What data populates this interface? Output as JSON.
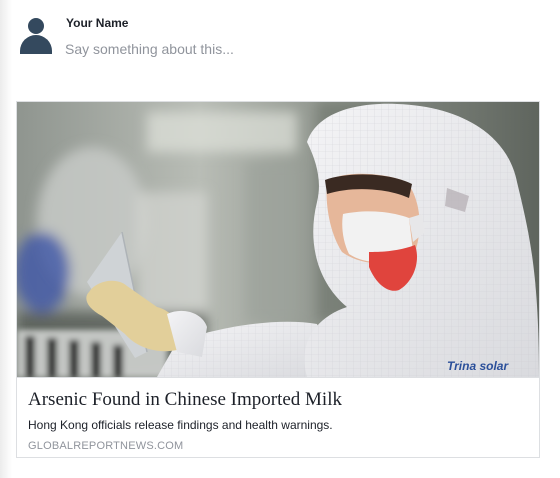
{
  "composer": {
    "user_name": "Your Name",
    "placeholder": "Say something about this...",
    "avatar_icon": "user-silhouette-icon"
  },
  "link_preview": {
    "title": "Arsenic Found in Chinese Imported Milk",
    "description": "Hong Kong officials release findings and health warnings.",
    "domain": "GLOBALREPORTNEWS.COM",
    "image_logo_text": "Trina solar"
  },
  "colors": {
    "avatar": "#34495e",
    "text_primary": "#1d2129",
    "text_secondary": "#90949c",
    "border": "#dddfe2"
  }
}
